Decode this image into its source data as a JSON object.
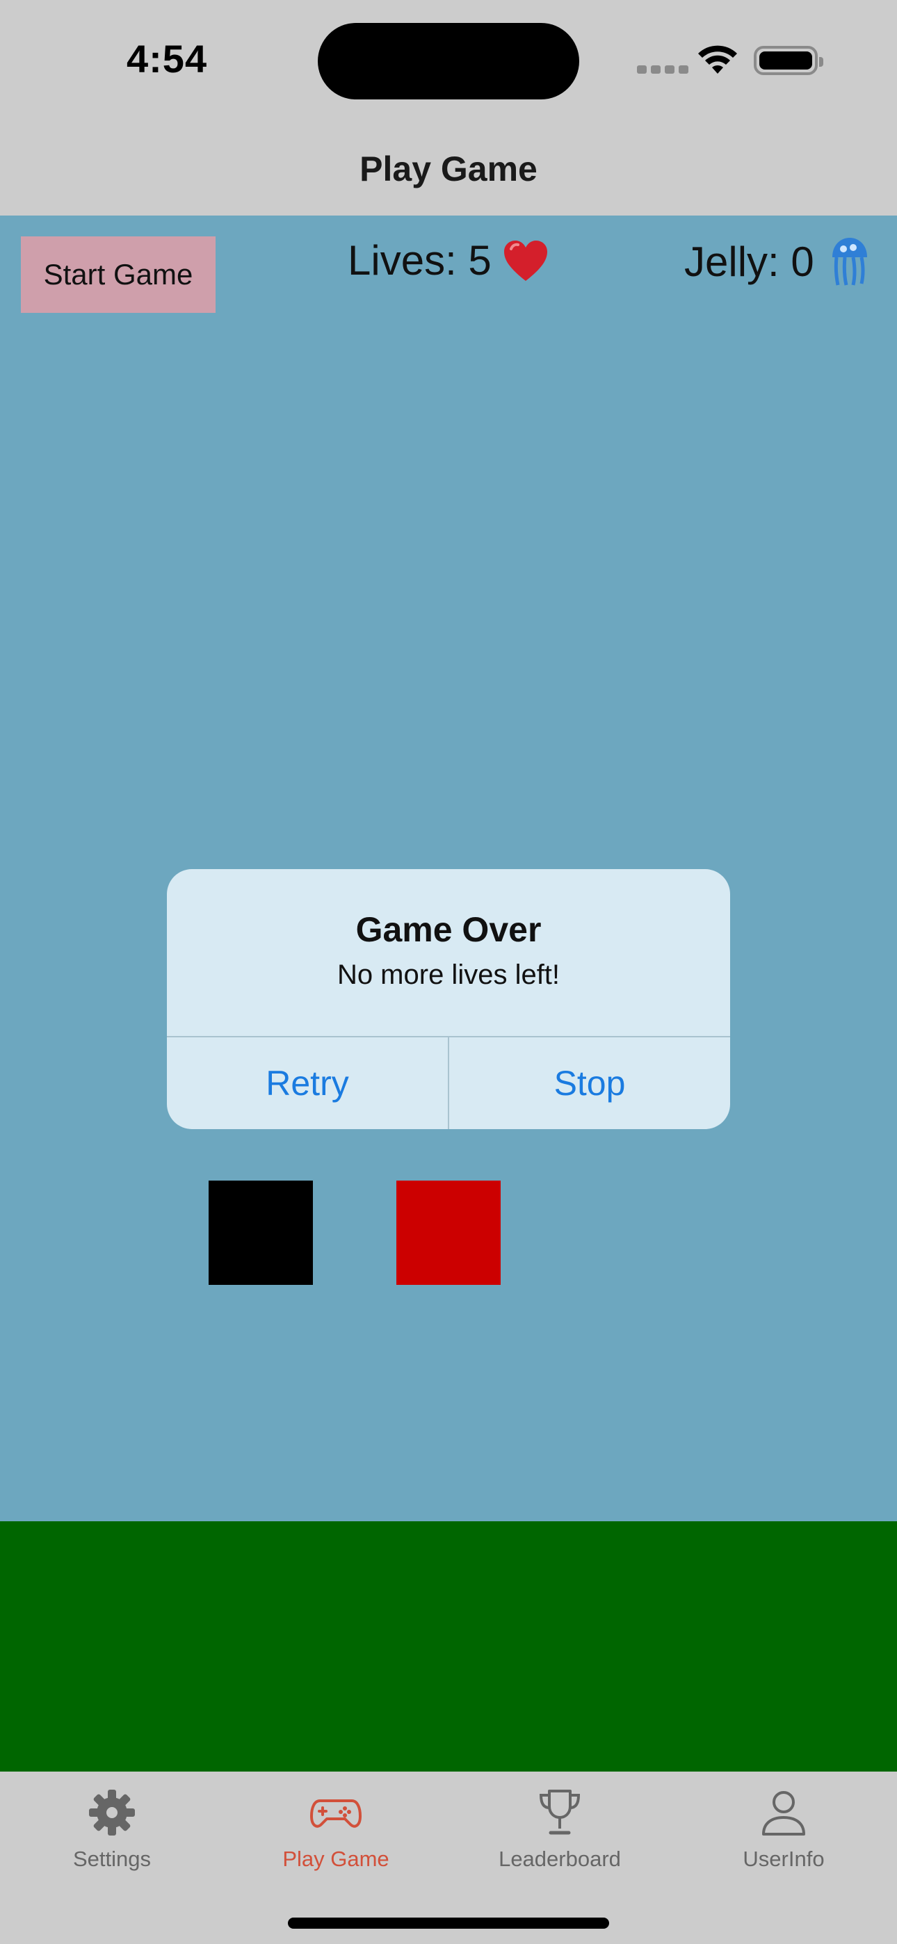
{
  "status_bar": {
    "time": "4:54"
  },
  "nav": {
    "title": "Play Game"
  },
  "game": {
    "start_label": "Start Game",
    "lives_text": "Lives: 5",
    "jelly_text": "Jelly: 0"
  },
  "alert": {
    "title": "Game Over",
    "message": "No more lives left!",
    "retry_label": "Retry",
    "stop_label": "Stop"
  },
  "tabs": [
    {
      "label": "Settings",
      "icon": "gear-icon",
      "active": false
    },
    {
      "label": "Play Game",
      "icon": "gamecontroller-icon",
      "active": true
    },
    {
      "label": "Leaderboard",
      "icon": "trophy-icon",
      "active": false
    },
    {
      "label": "UserInfo",
      "icon": "person-icon",
      "active": false
    }
  ],
  "colors": {
    "game_background": "#6da7bf",
    "ground": "#006600",
    "start_button": "#cf9fab",
    "player_block": "#000000",
    "enemy_block": "#cc0000",
    "accent": "#d2503a",
    "alert_button_text": "#1a7be0"
  }
}
